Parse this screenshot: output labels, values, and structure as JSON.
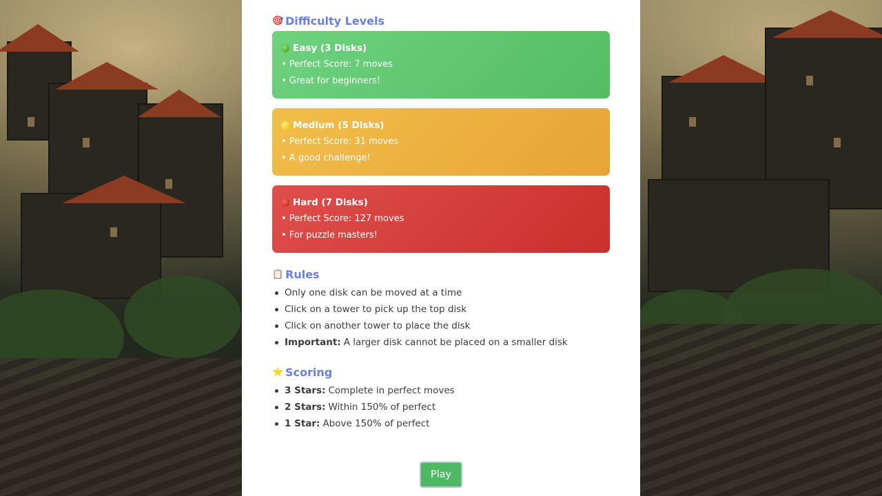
{
  "difficulty": {
    "title": "Difficulty Levels",
    "icon": "target-icon",
    "levels": [
      {
        "name": "Easy (3 Disks)",
        "color": "#5cc56a",
        "dot": "green-circle-icon",
        "lines": [
          "• Perfect Score: 7 moves",
          "• Great for beginners!"
        ]
      },
      {
        "name": "Medium (5 Disks)",
        "color": "#ecb13f",
        "dot": "yellow-circle-icon",
        "lines": [
          "• Perfect Score: 31 moves",
          "• A good challenge!"
        ]
      },
      {
        "name": "Hard (7 Disks)",
        "color": "#d53f3b",
        "dot": "red-circle-icon",
        "lines": [
          "• Perfect Score: 127 moves",
          "• For puzzle masters!"
        ]
      }
    ]
  },
  "rules": {
    "title": "Rules",
    "icon": "clipboard-icon",
    "items": [
      {
        "bold": "",
        "text": "Only one disk can be moved at a time"
      },
      {
        "bold": "",
        "text": "Click on a tower to pick up the top disk"
      },
      {
        "bold": "",
        "text": "Click on another tower to place the disk"
      },
      {
        "bold": "Important:",
        "text": "A larger disk cannot be placed on a smaller disk"
      }
    ]
  },
  "scoring": {
    "title": "Scoring",
    "icon": "star-icon",
    "items": [
      {
        "bold": "3 Stars:",
        "text": "Complete in perfect moves"
      },
      {
        "bold": "2 Stars:",
        "text": "Within 150% of perfect"
      },
      {
        "bold": "1 Star:",
        "text": "Above 150% of perfect"
      }
    ]
  },
  "play_button": {
    "label": "Play",
    "color": "#4fb865"
  }
}
